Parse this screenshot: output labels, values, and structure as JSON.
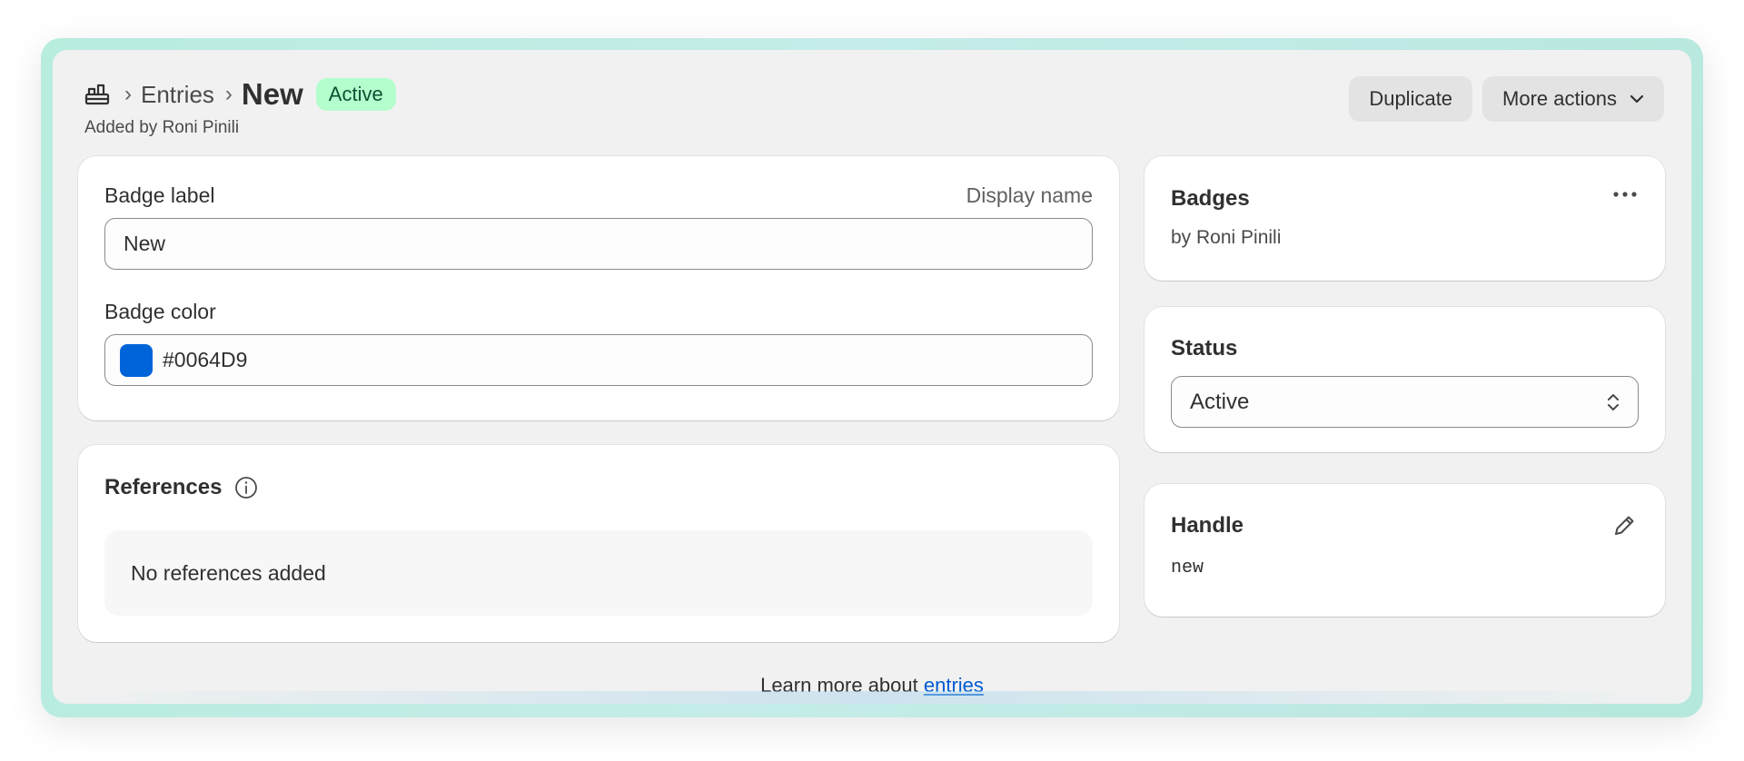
{
  "breadcrumb": {
    "home_icon": "metaobject-icon",
    "parent": "Entries",
    "current": "New",
    "status_badge": "Active"
  },
  "subtitle": "Added by Roni Pinili",
  "actions": {
    "duplicate": "Duplicate",
    "more_actions": "More actions"
  },
  "fields": {
    "badge_label": {
      "label": "Badge label",
      "aux": "Display name",
      "value": "New"
    },
    "badge_color": {
      "label": "Badge color",
      "value": "#0064D9",
      "swatch_color": "#0064D9"
    }
  },
  "references": {
    "title": "References",
    "empty_text": "No references added"
  },
  "definition": {
    "title": "Badges",
    "author": "by Roni Pinili"
  },
  "status": {
    "title": "Status",
    "selected": "Active"
  },
  "handle": {
    "title": "Handle",
    "value": "new"
  },
  "footer": {
    "prefix": "Learn more about ",
    "link": "entries"
  },
  "colors": {
    "accent_link": "#005bd3",
    "badge_bg": "#b4fdcd",
    "frame": "#b7ecdf"
  }
}
